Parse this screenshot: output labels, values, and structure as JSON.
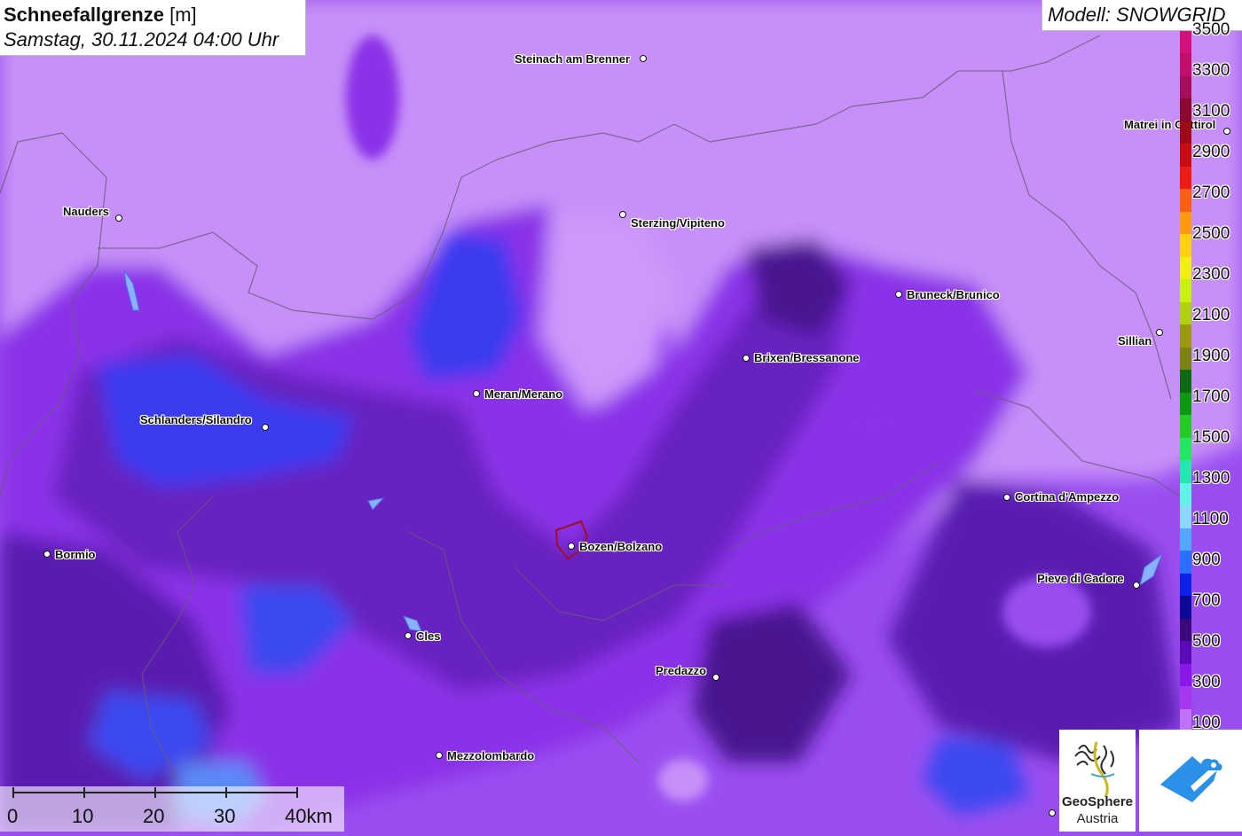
{
  "header": {
    "title": "Schneefallgrenze",
    "unit": "[m]",
    "datetime": "Samstag, 30.11.2024 04:00 Uhr"
  },
  "model": {
    "label": "Modell: SNOWGRID"
  },
  "cities": [
    {
      "id": "steinach",
      "name": "Steinach am Brenner"
    },
    {
      "id": "matrei",
      "name": "Matrei in Osttirol"
    },
    {
      "id": "nauders",
      "name": "Nauders"
    },
    {
      "id": "sterzing",
      "name": "Sterzing/Vipiteno"
    },
    {
      "id": "bruneck",
      "name": "Bruneck/Brunico"
    },
    {
      "id": "sillian",
      "name": "Sillian"
    },
    {
      "id": "brixen",
      "name": "Brixen/Bressanone"
    },
    {
      "id": "meran",
      "name": "Meran/Merano"
    },
    {
      "id": "schlanders",
      "name": "Schlanders/Silandro"
    },
    {
      "id": "cortina",
      "name": "Cortina d'Ampezzo"
    },
    {
      "id": "bozen",
      "name": "Bozen/Bolzano"
    },
    {
      "id": "bormio",
      "name": "Bormio"
    },
    {
      "id": "pieve",
      "name": "Pieve di Cadore"
    },
    {
      "id": "cles",
      "name": "Cles"
    },
    {
      "id": "predazzo",
      "name": "Predazzo"
    },
    {
      "id": "mezzolombardo",
      "name": "Mezzolombardo"
    }
  ],
  "legend": {
    "labels": [
      "3500",
      "3300",
      "3100",
      "2900",
      "2700",
      "2500",
      "2300",
      "2100",
      "1900",
      "1700",
      "1500",
      "1300",
      "1100",
      "900",
      "700",
      "500",
      "300",
      "100"
    ],
    "colors": [
      "#d4107a",
      "#c20e6a",
      "#a80c5c",
      "#8c0a30",
      "#a00a14",
      "#c80c10",
      "#ee1c12",
      "#ff6010",
      "#ff9a10",
      "#ffd010",
      "#f2ee10",
      "#c8f010",
      "#b0d010",
      "#9a9a10",
      "#7a8410",
      "#0a6a10",
      "#0a9a10",
      "#22cc22",
      "#22e860",
      "#22e8b0",
      "#60f4e8",
      "#8ad8ff",
      "#52a8ff",
      "#2a70ff",
      "#0a22e8",
      "#0a0a98",
      "#3a0a7a",
      "#5a0ab8",
      "#8a18e8",
      "#a838f0",
      "#c072f8"
    ]
  },
  "scale": {
    "labels": [
      "0",
      "10",
      "20",
      "30",
      "40km"
    ]
  },
  "logos": {
    "geosphere_line1": "GeoSphere",
    "geosphere_line2": "Austria"
  }
}
